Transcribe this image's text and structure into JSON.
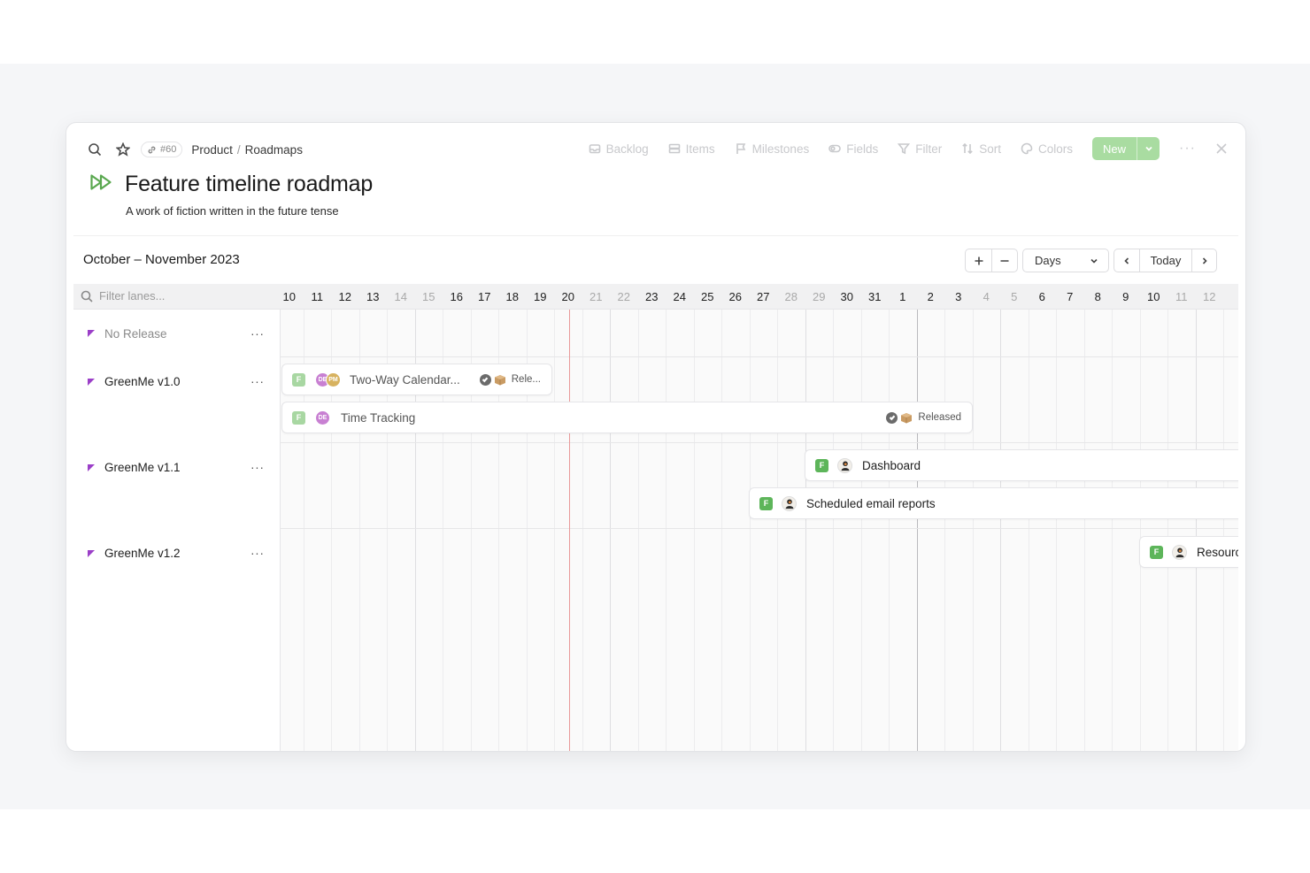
{
  "toolbar": {
    "item_id": "#60",
    "breadcrumb": [
      "Product",
      "Roadmaps"
    ],
    "breadcrumb_sep": "/",
    "actions": [
      "Backlog",
      "Items",
      "Milestones",
      "Fields",
      "Filter",
      "Sort",
      "Colors"
    ],
    "new_label": "New"
  },
  "page": {
    "title": "Feature timeline roadmap",
    "subtitle": "A work of fiction written in the future tense"
  },
  "range": {
    "title": "October – November 2023",
    "zoom_in": "+",
    "zoom_out": "−",
    "scale": "Days",
    "today_label": "Today"
  },
  "grid": {
    "filter_placeholder": "Filter lanes...",
    "days": [
      {
        "d": "10",
        "weekend": false
      },
      {
        "d": "11",
        "weekend": false
      },
      {
        "d": "12",
        "weekend": false
      },
      {
        "d": "13",
        "weekend": false
      },
      {
        "d": "14",
        "weekend": true
      },
      {
        "d": "15",
        "weekend": true
      },
      {
        "d": "16",
        "weekend": false
      },
      {
        "d": "17",
        "weekend": false
      },
      {
        "d": "18",
        "weekend": false
      },
      {
        "d": "19",
        "weekend": false
      },
      {
        "d": "20",
        "weekend": false
      },
      {
        "d": "21",
        "weekend": true
      },
      {
        "d": "22",
        "weekend": true
      },
      {
        "d": "23",
        "weekend": false
      },
      {
        "d": "24",
        "weekend": false
      },
      {
        "d": "25",
        "weekend": false
      },
      {
        "d": "26",
        "weekend": false
      },
      {
        "d": "27",
        "weekend": false
      },
      {
        "d": "28",
        "weekend": true
      },
      {
        "d": "29",
        "weekend": true
      },
      {
        "d": "30",
        "weekend": false
      },
      {
        "d": "31",
        "weekend": false
      },
      {
        "d": "1",
        "weekend": false
      },
      {
        "d": "2",
        "weekend": false
      },
      {
        "d": "3",
        "weekend": false
      },
      {
        "d": "4",
        "weekend": true
      },
      {
        "d": "5",
        "weekend": true
      },
      {
        "d": "6",
        "weekend": false
      },
      {
        "d": "7",
        "weekend": false
      },
      {
        "d": "8",
        "weekend": false
      },
      {
        "d": "9",
        "weekend": false
      },
      {
        "d": "10",
        "weekend": false
      },
      {
        "d": "11",
        "weekend": true
      },
      {
        "d": "12",
        "weekend": true
      }
    ]
  },
  "lanes": [
    {
      "name": "No Release",
      "muted": true,
      "more": "···"
    },
    {
      "name": "GreenMe v1.0",
      "muted": false,
      "more": "···"
    },
    {
      "name": "GreenMe v1.1",
      "muted": false,
      "more": "···"
    },
    {
      "name": "GreenMe v1.2",
      "muted": false,
      "more": "···"
    }
  ],
  "items": [
    {
      "title": "Two-Way Calendar...",
      "badge": "F",
      "avatars": [
        "DE",
        "PM"
      ],
      "status": "Rele..."
    },
    {
      "title": "Time Tracking",
      "badge": "F",
      "avatars": [
        "DE"
      ],
      "status": "Released"
    },
    {
      "title": "Dashboard",
      "badge": "F"
    },
    {
      "title": "Scheduled email reports",
      "badge": "F"
    },
    {
      "title": "Resourc",
      "badge": "F"
    }
  ],
  "colors": {
    "accent_green": "#5db55a",
    "today_line": "#e89a9a",
    "lane_flag": "#9b3fc8"
  }
}
